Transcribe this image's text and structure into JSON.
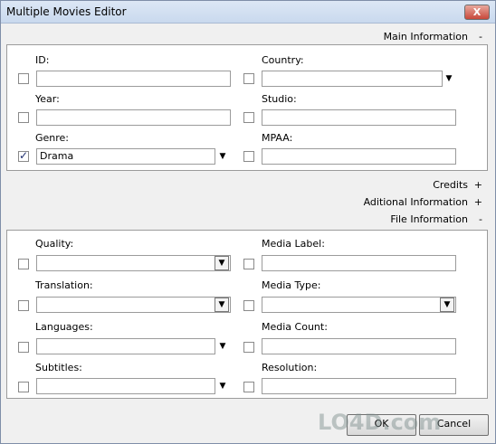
{
  "window": {
    "title": "Multiple Movies Editor",
    "close_label": "X"
  },
  "sections": {
    "main": {
      "label": "Main Information",
      "toggle": "-"
    },
    "credits": {
      "label": "Credits",
      "toggle": "+"
    },
    "additional": {
      "label": "Aditional Information",
      "toggle": "+"
    },
    "file": {
      "label": "File Information",
      "toggle": "-"
    }
  },
  "main_fields": {
    "id": {
      "label": "ID:",
      "value": ""
    },
    "country": {
      "label": "Country:",
      "value": ""
    },
    "year": {
      "label": "Year:",
      "value": ""
    },
    "studio": {
      "label": "Studio:",
      "value": ""
    },
    "genre": {
      "label": "Genre:",
      "value": "Drama"
    },
    "mpaa": {
      "label": "MPAA:",
      "value": ""
    }
  },
  "file_fields": {
    "quality": {
      "label": "Quality:",
      "value": ""
    },
    "media_label": {
      "label": "Media Label:",
      "value": ""
    },
    "translation": {
      "label": "Translation:",
      "value": ""
    },
    "media_type": {
      "label": "Media Type:",
      "value": ""
    },
    "languages": {
      "label": "Languages:",
      "value": ""
    },
    "media_count": {
      "label": "Media Count:",
      "value": ""
    },
    "subtitles": {
      "label": "Subtitles:",
      "value": ""
    },
    "resolution": {
      "label": "Resolution:",
      "value": ""
    }
  },
  "buttons": {
    "ok": "OK",
    "cancel": "Cancel"
  },
  "watermark": "LO4D.com"
}
